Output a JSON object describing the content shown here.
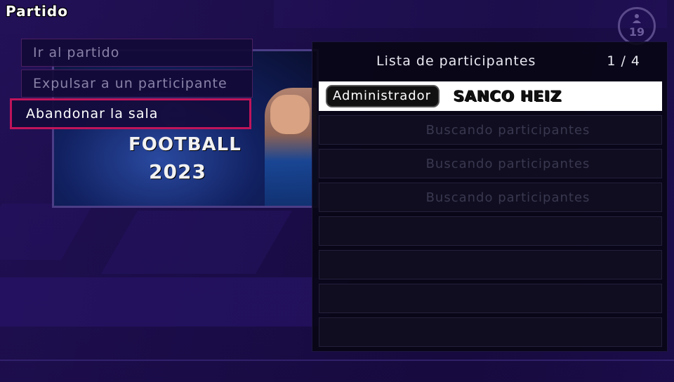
{
  "screen": {
    "title": "Partido",
    "badge_label": "19"
  },
  "banner": {
    "game_title": "FOOTBALL",
    "game_year": "2023"
  },
  "menu": {
    "items": [
      {
        "label": "Ir al partido",
        "selected": false
      },
      {
        "label": "Expulsar a un participante",
        "selected": false
      },
      {
        "label": "Abandonar la sala",
        "selected": true
      }
    ]
  },
  "participants": {
    "title": "Lista de participantes",
    "count": "1 / 4",
    "host": {
      "role": "Administrador",
      "name": "SANCO HEIZ"
    },
    "slots": [
      {
        "status": "Buscando participantes"
      },
      {
        "status": "Buscando participantes"
      },
      {
        "status": "Buscando participantes"
      },
      {
        "status": ""
      },
      {
        "status": ""
      },
      {
        "status": ""
      },
      {
        "status": ""
      }
    ]
  },
  "colors": {
    "background": "#1b0f45",
    "selection_border": "#c0145a",
    "panel": "#08061a",
    "host_row": "#ffffff"
  }
}
